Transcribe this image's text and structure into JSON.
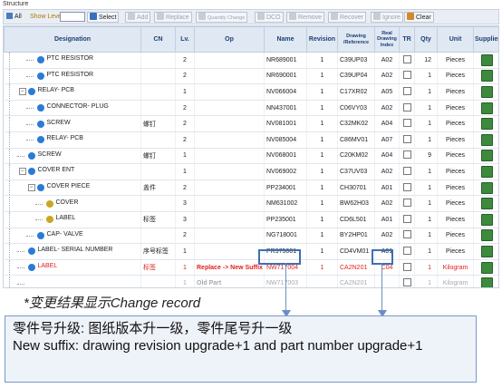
{
  "window": {
    "title": "Structure"
  },
  "toolbar": {
    "all_label": "All",
    "show_level_label": "Show Level",
    "select_label": "Select",
    "add_label": "Add",
    "replace_label": "Replace",
    "quantity_change_label": "Quantity Change",
    "dco_label": "DCO",
    "remove_label": "Remove",
    "recover_label": "Recover",
    "ignore_label": "Ignore",
    "clear_label": "Clear"
  },
  "columns": [
    "Designation",
    "CN",
    "Lv.",
    "Op",
    "Name",
    "Revision",
    "Drawing /Reference",
    "Real Drawing Index",
    "TR",
    "Qty",
    "Unit",
    "Supplier"
  ],
  "rows": [
    {
      "designation": "PTC RESISTOR",
      "cn": "",
      "lv": "2",
      "op": "",
      "name": "NR689001",
      "revision": "1",
      "drawing": "C39UP03",
      "index": "A02",
      "qty": "12",
      "unit": "Pieces",
      "depth": 1,
      "expander": "",
      "gear": "blue",
      "style": "normal"
    },
    {
      "designation": "PTC RESISTOR",
      "cn": "",
      "lv": "2",
      "op": "",
      "name": "NR690001",
      "revision": "1",
      "drawing": "C39UP04",
      "index": "A02",
      "qty": "1",
      "unit": "Pieces",
      "depth": 1,
      "expander": "",
      "gear": "blue",
      "style": "normal"
    },
    {
      "designation": "RELAY- PCB",
      "cn": "",
      "lv": "1",
      "op": "",
      "name": "NV066004",
      "revision": "1",
      "drawing": "C17XR02",
      "index": "A05",
      "qty": "1",
      "unit": "Pieces",
      "depth": 0,
      "expander": "−",
      "gear": "blue",
      "style": "normal"
    },
    {
      "designation": "CONNECTOR- PLUG",
      "cn": "",
      "lv": "2",
      "op": "",
      "name": "NN437001",
      "revision": "1",
      "drawing": "C06VY03",
      "index": "A02",
      "qty": "1",
      "unit": "Pieces",
      "depth": 1,
      "expander": "",
      "gear": "blue",
      "style": "normal"
    },
    {
      "designation": "SCREW",
      "cn": "螺钉",
      "lv": "2",
      "op": "",
      "name": "NV081001",
      "revision": "1",
      "drawing": "C32MK02",
      "index": "A04",
      "qty": "1",
      "unit": "Pieces",
      "depth": 1,
      "expander": "",
      "gear": "blue",
      "style": "normal"
    },
    {
      "designation": "RELAY- PCB",
      "cn": "",
      "lv": "2",
      "op": "",
      "name": "NV085004",
      "revision": "1",
      "drawing": "C86MV01",
      "index": "A07",
      "qty": "1",
      "unit": "Pieces",
      "depth": 1,
      "expander": "",
      "gear": "blue",
      "style": "normal"
    },
    {
      "designation": "SCREW",
      "cn": "螺钉",
      "lv": "1",
      "op": "",
      "name": "NV068001",
      "revision": "1",
      "drawing": "C20KM02",
      "index": "A04",
      "qty": "9",
      "unit": "Pieces",
      "depth": 0,
      "expander": "",
      "gear": "blue",
      "style": "normal"
    },
    {
      "designation": "COVER ENT",
      "cn": "",
      "lv": "1",
      "op": "",
      "name": "NV069002",
      "revision": "1",
      "drawing": "C37UV03",
      "index": "A02",
      "qty": "1",
      "unit": "Pieces",
      "depth": 0,
      "expander": "−",
      "gear": "blue",
      "style": "normal"
    },
    {
      "designation": "COVER PIECE",
      "cn": "盖件",
      "lv": "2",
      "op": "",
      "name": "PP234001",
      "revision": "1",
      "drawing": "CH30701",
      "index": "A01",
      "qty": "1",
      "unit": "Pieces",
      "depth": 1,
      "expander": "−",
      "gear": "blue",
      "style": "normal"
    },
    {
      "designation": "COVER",
      "cn": "",
      "lv": "3",
      "op": "",
      "name": "NM631002",
      "revision": "1",
      "drawing": "BW62H03",
      "index": "A02",
      "qty": "1",
      "unit": "Pieces",
      "depth": 2,
      "expander": "",
      "gear": "yellow",
      "style": "normal"
    },
    {
      "designation": "LABEL",
      "cn": "标签",
      "lv": "3",
      "op": "",
      "name": "PP235001",
      "revision": "1",
      "drawing": "CD6L501",
      "index": "A01",
      "qty": "1",
      "unit": "Pieces",
      "depth": 2,
      "expander": "",
      "gear": "yellow",
      "style": "normal"
    },
    {
      "designation": "CAP- VALVE",
      "cn": "",
      "lv": "2",
      "op": "",
      "name": "NG718001",
      "revision": "1",
      "drawing": "BY2HP01",
      "index": "A02",
      "qty": "1",
      "unit": "Pieces",
      "depth": 1,
      "expander": "",
      "gear": "blue",
      "style": "normal"
    },
    {
      "designation": "LABEL- SERIAL NUMBER",
      "cn": "序号标签",
      "lv": "1",
      "op": "",
      "name": "PR975001",
      "revision": "1",
      "drawing": "CD4VM01",
      "index": "A01",
      "qty": "1",
      "unit": "Pieces",
      "depth": 0,
      "expander": "",
      "gear": "blue",
      "style": "normal"
    },
    {
      "designation": "LABEL",
      "cn": "标签",
      "lv": "1",
      "op": "Replace -> New Suffix",
      "name": "NW717004",
      "revision": "1",
      "drawing": "CA2N201",
      "index": "C04",
      "qty": "1",
      "unit": "Kilogram",
      "depth": 0,
      "expander": "",
      "gear": "blue",
      "style": "red"
    },
    {
      "designation": "",
      "cn": "",
      "lv": "1",
      "op": "Old Part",
      "name": "NW717003",
      "revision": "",
      "drawing": "CA2N201",
      "index": "",
      "qty": "1",
      "unit": "Kilogram",
      "depth": 0,
      "expander": "",
      "gear": "blue",
      "style": "grey"
    }
  ],
  "annotation": {
    "note": "*变更结果显示Change record",
    "callout_line1": "零件号升级: 图纸版本升一级，零件尾号升一级",
    "callout_line2": "New suffix: drawing revision upgrade+1 and part number upgrade+1"
  },
  "colors": {
    "changed_text": "#e0221e",
    "header_text": "#1f3f73",
    "highlight_box": "#3d6fb5"
  }
}
